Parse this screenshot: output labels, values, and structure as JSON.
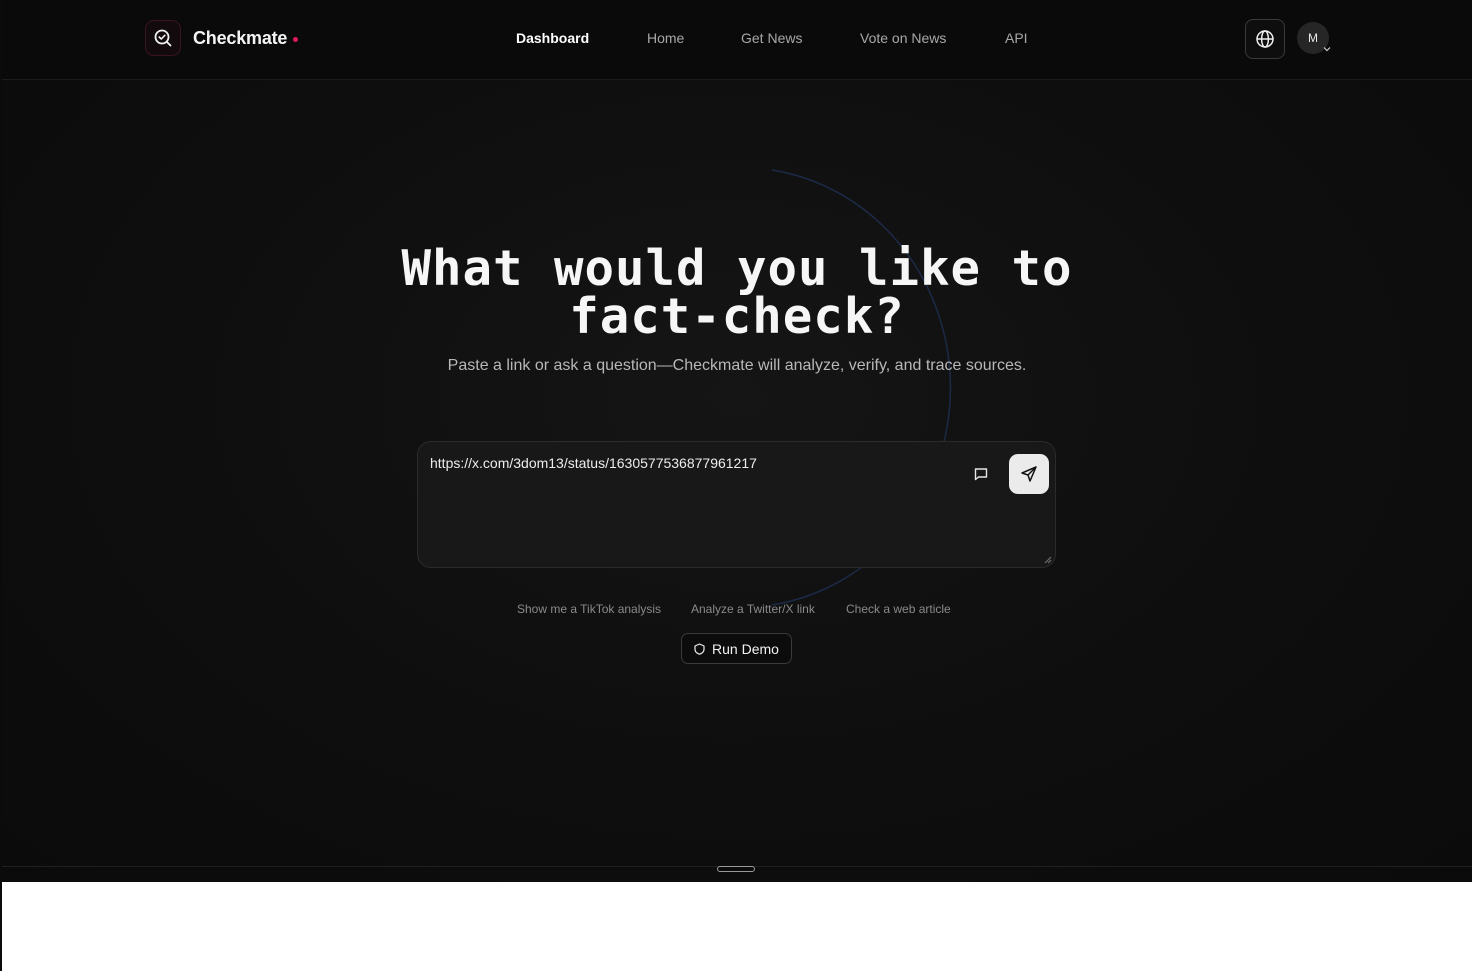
{
  "brand": {
    "name": "Checkmate",
    "logo_icon": "search-check-icon",
    "accent_color": "#e0195a"
  },
  "nav": {
    "items": [
      {
        "label": "Dashboard",
        "active": true
      },
      {
        "label": "Home",
        "active": false
      },
      {
        "label": "Get News",
        "active": false
      },
      {
        "label": "Vote on News",
        "active": false
      },
      {
        "label": "API",
        "active": false
      }
    ],
    "language_icon": "globe-icon",
    "avatar_initial": "M"
  },
  "hero": {
    "title_line1": "What would you like to",
    "title_line2": "fact-check?",
    "subtitle": "Paste a link or ask a question—Checkmate will analyze, verify, and trace sources."
  },
  "input": {
    "value": "https://x.com/3dom13/status/1630577536877961217",
    "chat_icon": "message-square-icon",
    "send_icon": "send-icon"
  },
  "suggestions": [
    "Show me a TikTok analysis",
    "Analyze a Twitter/X link",
    "Check a web article"
  ],
  "demo": {
    "label": "Run Demo",
    "icon": "shield-icon"
  }
}
